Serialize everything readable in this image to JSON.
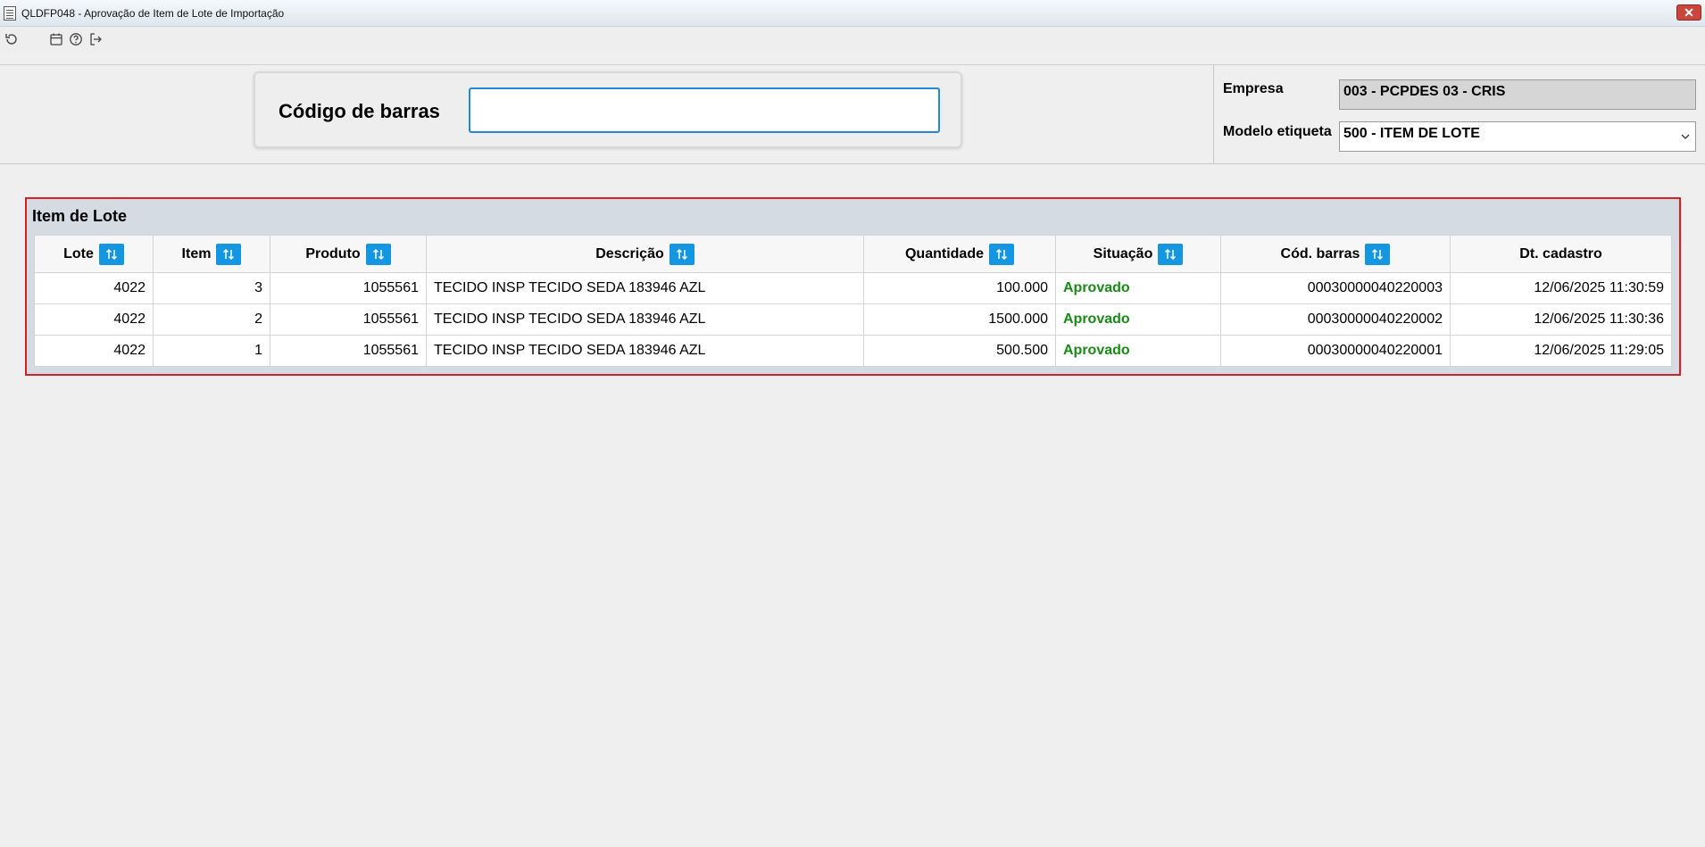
{
  "window": {
    "title": "QLDFP048 - Aprovação de Item de Lote de Importação",
    "close_glyph": "✕"
  },
  "toolbar": {
    "icons": [
      "refresh-icon",
      "calendar-icon",
      "help-icon",
      "exit-icon"
    ]
  },
  "header": {
    "barcode_label": "Código de barras",
    "barcode_value": "",
    "empresa_label": "Empresa",
    "empresa_value": "003 - PCPDES 03 - CRIS",
    "modelo_label": "Modelo etiqueta",
    "modelo_value": "500 - ITEM DE LOTE"
  },
  "panel": {
    "title": "Item de Lote",
    "columns": [
      "Lote",
      "Item",
      "Produto",
      "Descrição",
      "Quantidade",
      "Situação",
      "Cód. barras",
      "Dt. cadastro"
    ],
    "rows": [
      [
        "4022",
        "3",
        "1055561",
        "TECIDO INSP TECIDO SEDA 183946 AZL",
        "100.000",
        "Aprovado",
        "00030000040220003",
        "12/06/2025 11:30:59"
      ],
      [
        "4022",
        "2",
        "1055561",
        "TECIDO INSP TECIDO SEDA 183946 AZL",
        "1500.000",
        "Aprovado",
        "00030000040220002",
        "12/06/2025 11:30:36"
      ],
      [
        "4022",
        "1",
        "1055561",
        "TECIDO INSP TECIDO SEDA 183946 AZL",
        "500.500",
        "Aprovado",
        "00030000040220001",
        "12/06/2025 11:29:05"
      ]
    ]
  },
  "colors": {
    "accent": "#1596e0",
    "status_ok": "#1a8a16",
    "highlight_border": "#d32222"
  }
}
